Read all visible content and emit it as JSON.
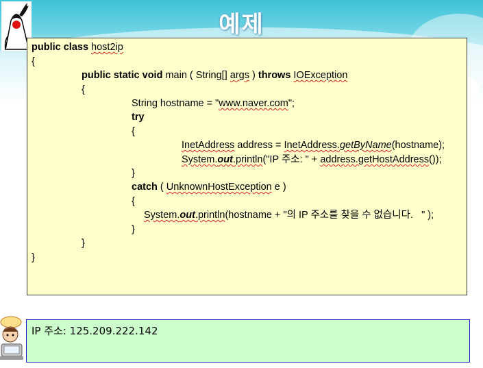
{
  "slide": {
    "title": "예제"
  },
  "code": {
    "line1": {
      "kw": "public class ",
      "name": "host2ip"
    },
    "line2": "{",
    "line3": {
      "kw": "public static void ",
      "method": "main ( String[] ",
      "args": "args",
      "mid": " ) ",
      "throws": "throws ",
      "exc": "IOException"
    },
    "line4": "{",
    "line5": {
      "pre": "String hostname = \"",
      "url": "www.naver.com",
      "post": "\";"
    },
    "line6": "try",
    "line7": "{",
    "line8": {
      "type": "InetAddress",
      "mid": " address = ",
      "cls": "InetAddress.",
      "call": "getByName",
      "post": "(hostname);"
    },
    "line9": {
      "sys": "System.",
      "out": "out",
      "println": ".println",
      "str": "(\"IP 주소: \" + ",
      "addr": "address.getHostAddress",
      "post": "());"
    },
    "line10": "}",
    "line11": {
      "kw": "catch",
      "open": " ( ",
      "exc": "UnknownHostException",
      "post": " e )"
    },
    "line12": "{",
    "line13": {
      "sys": "System.",
      "out": "out",
      "println": ".println",
      "post": "(hostname + \"의 IP 주소를 찾을 수 없습니다.   \" );"
    },
    "line14": "}",
    "line15": "}",
    "line16": "}"
  },
  "output": {
    "text": "IP 주소: 125.209.222.142"
  },
  "colors": {
    "code_bg": "#ffffcc",
    "output_bg": "#ccffcc",
    "output_border": "#1a1acc",
    "header_accent": "#3fc3d8"
  },
  "icons": {
    "logo": "java-duke-icon",
    "mascot": "cartoon-person-icon"
  }
}
